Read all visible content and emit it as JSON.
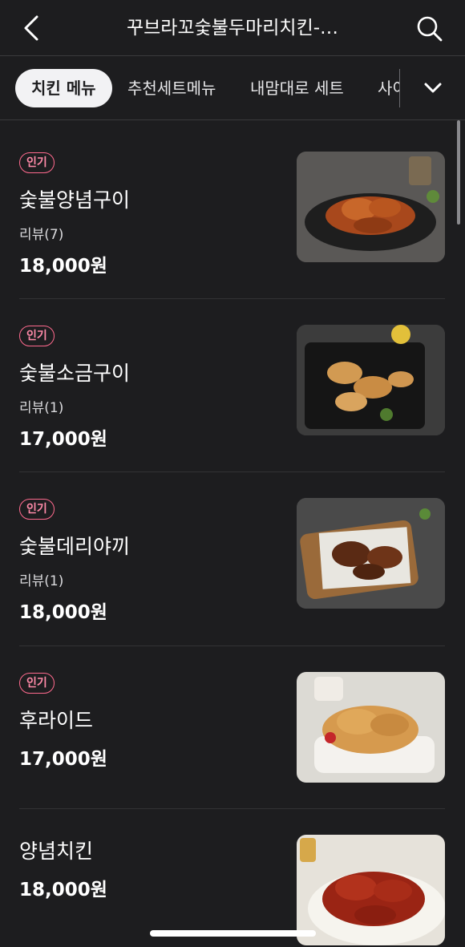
{
  "header": {
    "title": "꾸브라꼬숯불두마리치킨-…",
    "back_icon": "chevron-left-icon",
    "search_icon": "search-icon"
  },
  "tabs": [
    {
      "label": "치킨 메뉴",
      "active": true
    },
    {
      "label": "추천세트메뉴",
      "active": false
    },
    {
      "label": "내맘대로 세트",
      "active": false
    },
    {
      "label": "사이",
      "active": false
    }
  ],
  "expand_icon": "chevron-down-icon",
  "menu_items": [
    {
      "badge": "인기",
      "name": "숯불양념구이",
      "review": "리뷰(7)",
      "price": "18,000원",
      "image": "chicken-photo"
    },
    {
      "badge": "인기",
      "name": "숯불소금구이",
      "review": "리뷰(1)",
      "price": "17,000원",
      "image": "chicken-photo"
    },
    {
      "badge": "인기",
      "name": "숯불데리야끼",
      "review": "리뷰(1)",
      "price": "18,000원",
      "image": "chicken-photo"
    },
    {
      "badge": "인기",
      "name": "후라이드",
      "review": "",
      "price": "17,000원",
      "image": "chicken-photo"
    },
    {
      "badge": "",
      "name": "양념치킨",
      "review": "",
      "price": "18,000원",
      "image": "chicken-photo"
    }
  ],
  "colors": {
    "background": "#1d1d1f",
    "badge": "#ff6a8e",
    "active_tab_bg": "#f2f2f4"
  }
}
